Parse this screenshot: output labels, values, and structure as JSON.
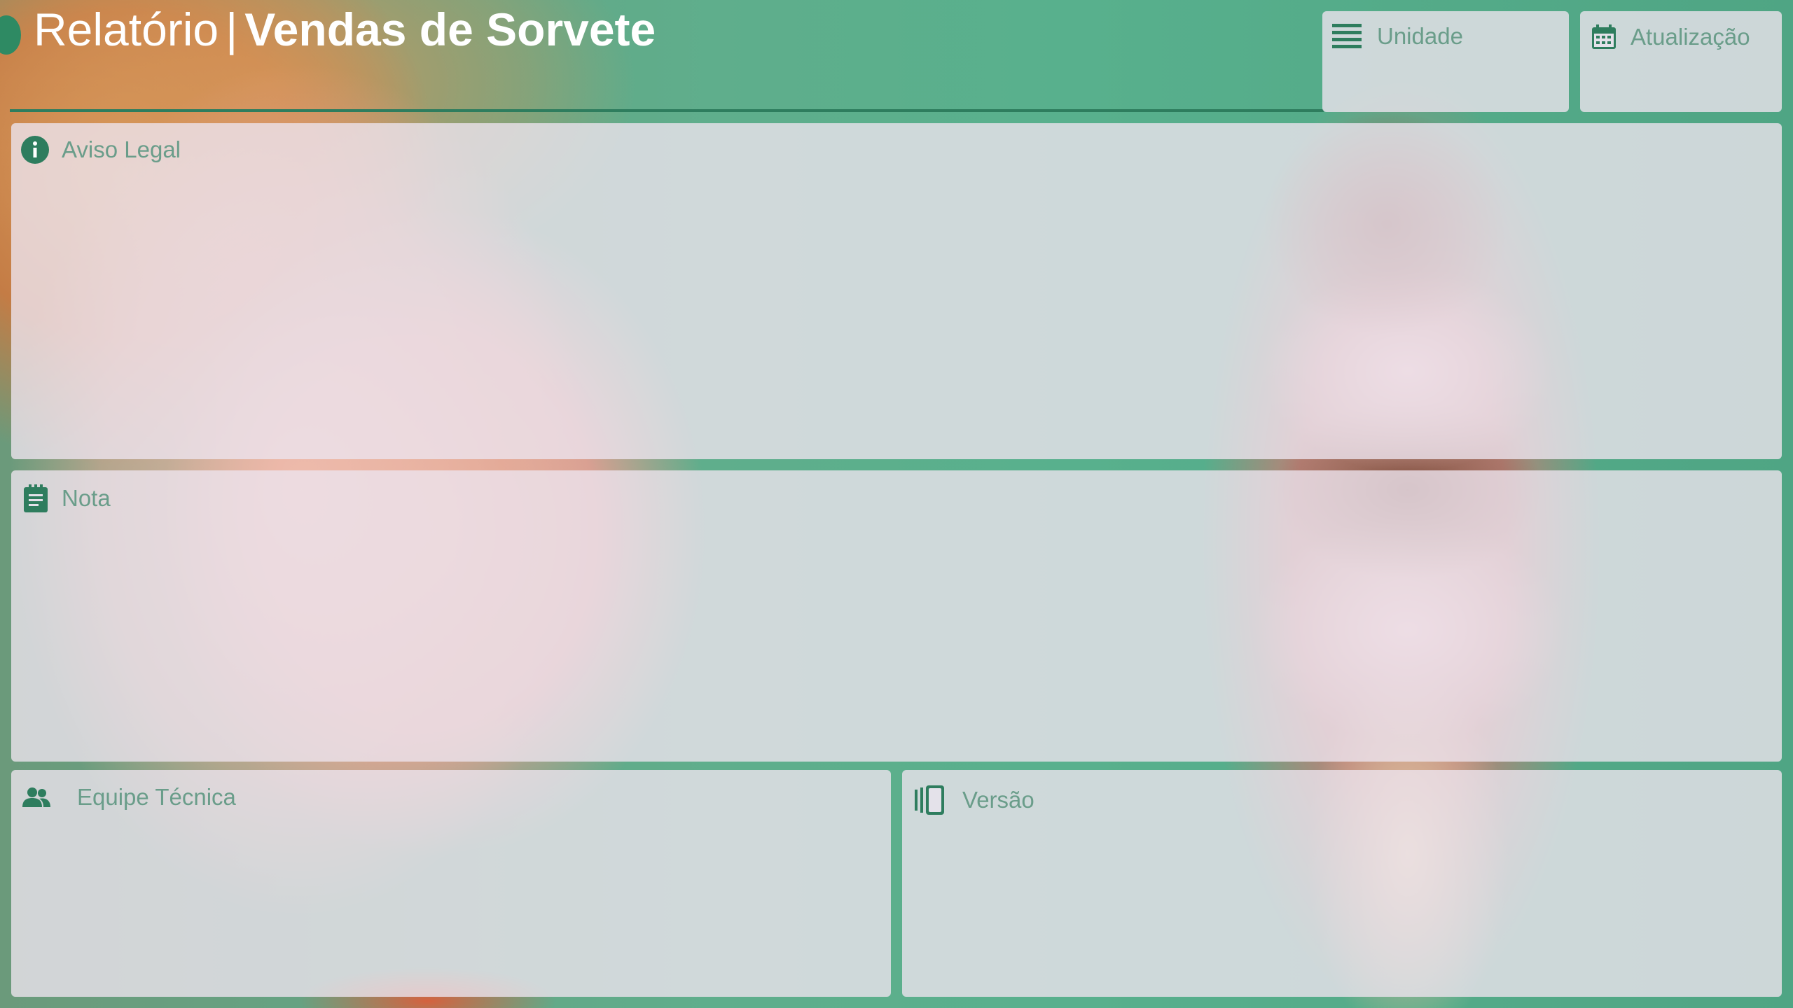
{
  "header": {
    "title_prefix": "Relatório",
    "title_separator": "|",
    "title_main": "Vendas de Sorvete"
  },
  "filters": {
    "unidade_label": "Unidade",
    "atualizacao_label": "Atualização"
  },
  "panels": {
    "aviso_legal": "Aviso Legal",
    "nota": "Nota",
    "equipe_tecnica": "Equipe Técnica",
    "versao": "Versão"
  },
  "icons": {
    "unidade": "list-lines-icon",
    "atualizacao": "calendar-icon",
    "aviso_legal": "info-icon",
    "nota": "notepad-icon",
    "equipe_tecnica": "people-icon",
    "versao": "versions-icon"
  },
  "colors": {
    "accent": "#2e7d5e",
    "label": "#6a9d8a",
    "panel": "#ece4ee",
    "title": "#ffffff"
  }
}
